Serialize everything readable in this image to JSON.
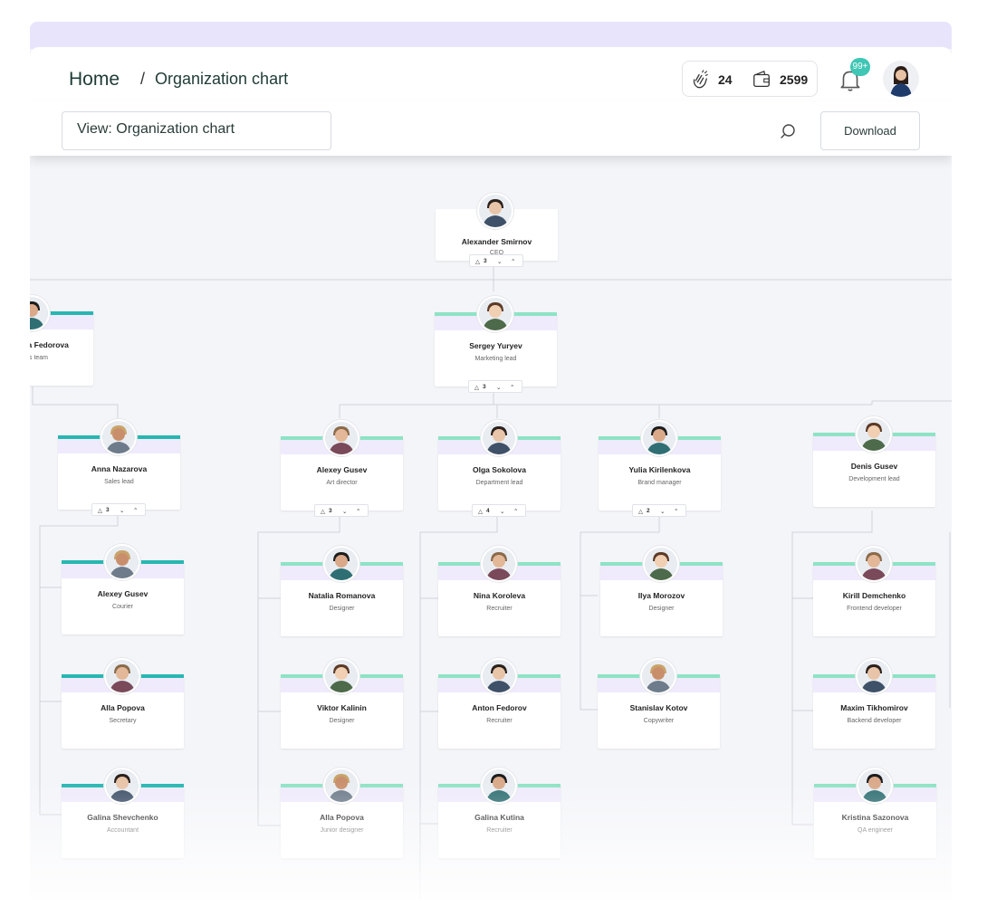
{
  "header": {
    "home_label": "Home",
    "separator": "/",
    "current_label": "Organization chart",
    "claps_count": "24",
    "wallet_count": "2599",
    "notification_badge": "99+"
  },
  "toolbar": {
    "view_label": "View: Organization chart",
    "download_label": "Download"
  },
  "colors": {
    "teal": "#27b7b1",
    "mint": "#8ee3c4",
    "lavender": "#efeafc",
    "badge": "#3fc6b5"
  },
  "org": {
    "ceo": {
      "name": "Alexander Smirnov",
      "role": "CEO",
      "count": "3"
    },
    "anastasia": {
      "name": "Anastasia Fedorova",
      "role": "Sales team"
    },
    "sergey": {
      "name": "Sergey Yuryev",
      "role": "Marketing lead",
      "count": "3"
    },
    "anna": {
      "name": "Anna Nazarova",
      "role": "Sales lead",
      "count": "3"
    },
    "alexey_g": {
      "name": "Alexey Gusev",
      "role": "Art director",
      "count": "3"
    },
    "olga": {
      "name": "Olga Sokolova",
      "role": "Department lead",
      "count": "4"
    },
    "yulia": {
      "name": "Yulia Kirilenkova",
      "role": "Brand manager",
      "count": "2"
    },
    "denis": {
      "name": "Denis Gusev",
      "role": "Development lead"
    },
    "alexey_c": {
      "name": "Alexey Gusev",
      "role": "Courier"
    },
    "alla_s": {
      "name": "Alla Popova",
      "role": "Secretary"
    },
    "galina_s": {
      "name": "Galina Shevchenko",
      "role": "Accountant"
    },
    "natalia": {
      "name": "Natalia Romanova",
      "role": "Designer"
    },
    "viktor": {
      "name": "Viktor Kalinin",
      "role": "Designer"
    },
    "alla_j": {
      "name": "Alla Popova",
      "role": "Junior designer"
    },
    "nina": {
      "name": "Nina Koroleva",
      "role": "Recruiter"
    },
    "anton": {
      "name": "Anton Fedorov",
      "role": "Recruiter"
    },
    "galina_k": {
      "name": "Galina Kutina",
      "role": "Recruiter"
    },
    "ilya": {
      "name": "Ilya Morozov",
      "role": "Designer"
    },
    "stanislav": {
      "name": "Stanislav Kotov",
      "role": "Copywriter"
    },
    "kirill": {
      "name": "Kirill Demchenko",
      "role": "Frontend developer"
    },
    "maxim": {
      "name": "Maxim Tikhomirov",
      "role": "Backend developer"
    },
    "kristina": {
      "name": "Kristina Sazonova",
      "role": "QA engineer"
    }
  }
}
